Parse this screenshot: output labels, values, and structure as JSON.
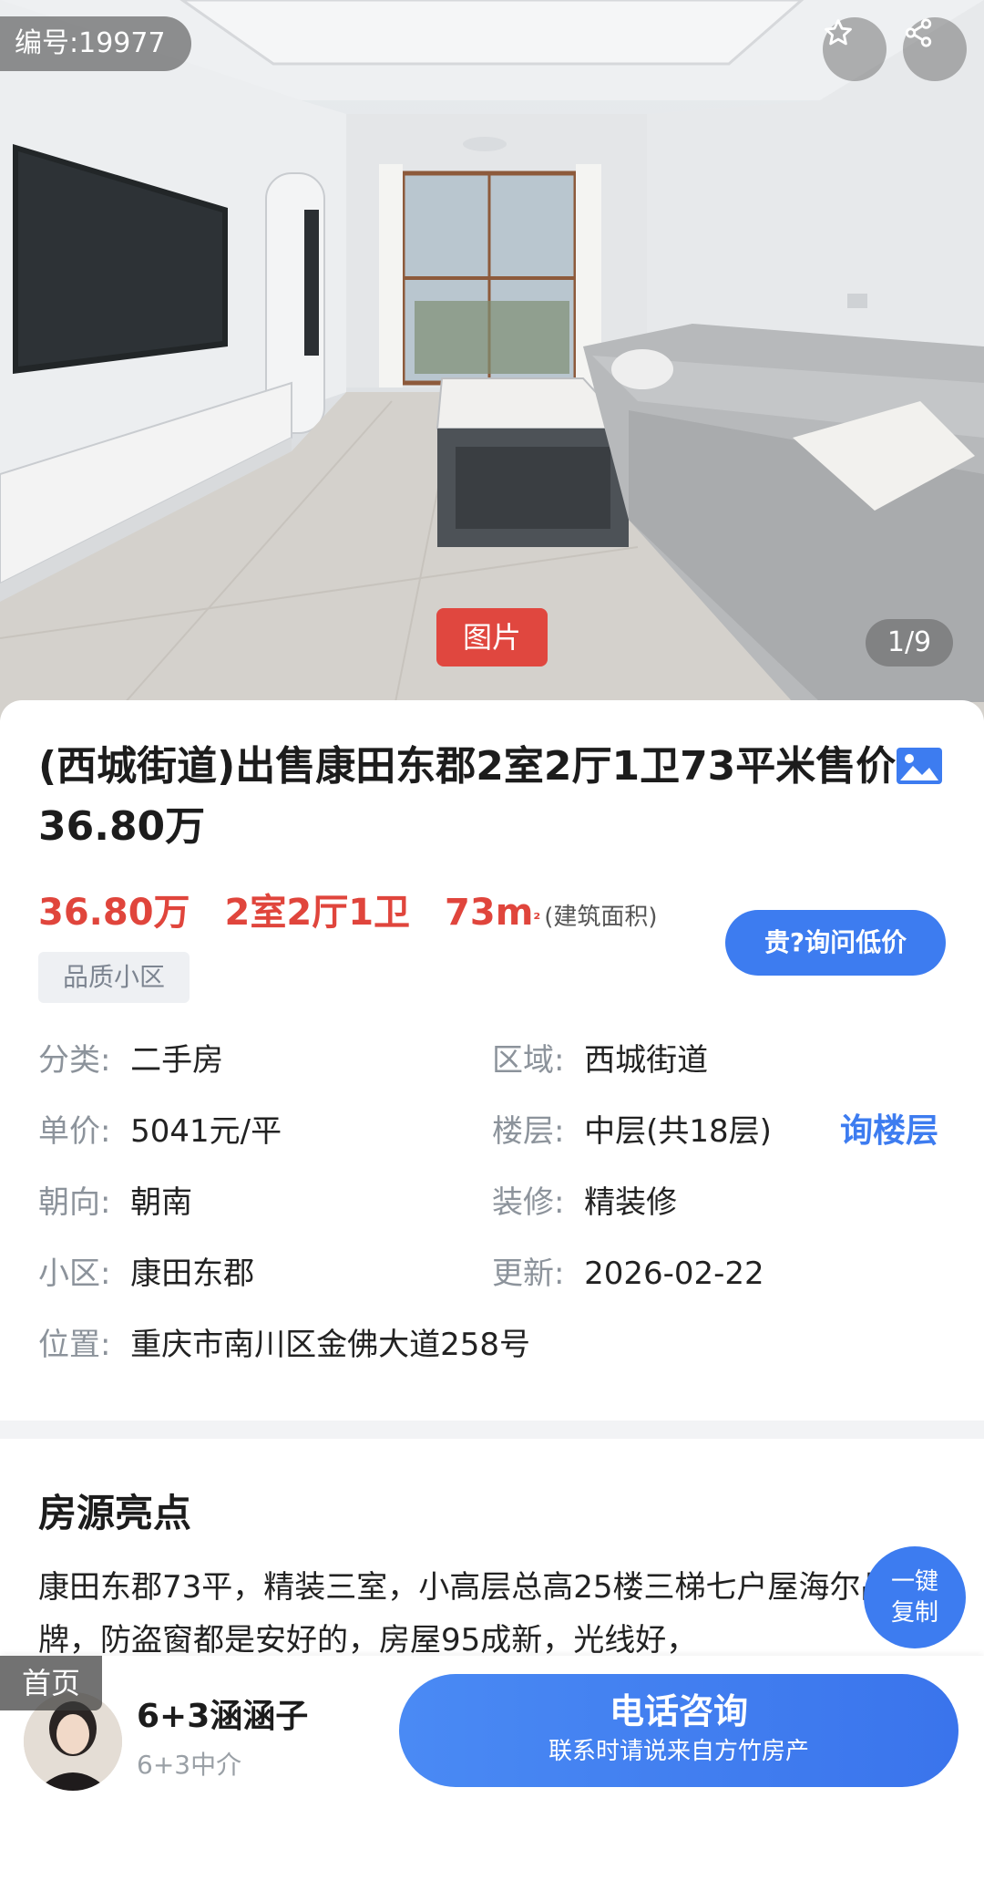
{
  "hero": {
    "listing_id": "编号:19977",
    "photo_tag": "图片",
    "photo_count": "1/9",
    "icons": [
      "star-icon",
      "share-icon"
    ]
  },
  "listing": {
    "title": "(西城街道)出售康田东郡2室2厅1卫73平米售价36.80万",
    "price": "36.80万",
    "layout": "2室2厅1卫",
    "area": "73m",
    "area_unit": "²",
    "area_note": "(建筑面积)",
    "quality_tag": "品质小区",
    "ask_price_button": "贵?询问低价",
    "ask_floor_link": "询楼层"
  },
  "info": {
    "category_key": "分类:",
    "category_value": "二手房",
    "region_key": "区域:",
    "region_value": "西城街道",
    "unit_price_key": "单价:",
    "unit_price_value": "5041元/平",
    "floor_key": "楼层:",
    "floor_value": "中层(共18层)",
    "orientation_key": "朝向:",
    "orientation_value": "朝南",
    "decoration_key": "装修:",
    "decoration_value": "精装修",
    "community_key": "小区:",
    "community_value": "康田东郡",
    "updated_key": "更新:",
    "updated_value": "2026-02-22",
    "location_key": "位置:",
    "location_value": "重庆市南川区金佛大道258号"
  },
  "highlights": {
    "title": "房源亮点",
    "text": "康田东郡73平，精装三室，小高层总高25楼三梯七户屋海尔品牌，防盗窗都是安好的，房屋95成新，光线好，",
    "copy_button": "一键复制"
  },
  "bottom_bar": {
    "home_tab": "首页",
    "agent_name": "6+3涵涵子",
    "agent_company": "6+3中介",
    "call_button": "电话咨询",
    "call_button_sub": "联系时请说来自方竹房产"
  },
  "colors": {
    "accent_blue": "#3d7cf0",
    "price_red": "#e0453c",
    "photo_tag_red": "#e0473f"
  }
}
